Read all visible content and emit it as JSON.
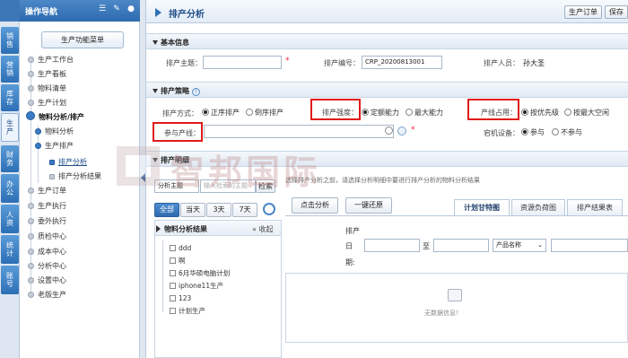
{
  "left_tabs": [
    "销售",
    "营销",
    "库存",
    "生产",
    "财务",
    "办公",
    "人资",
    "统计",
    "账号"
  ],
  "nav": {
    "title": "操作导航",
    "menu_button": "生产功能菜单",
    "items": [
      {
        "label": "生产工作台"
      },
      {
        "label": "生产看板"
      },
      {
        "label": "物料清单"
      },
      {
        "label": "生产计划"
      },
      {
        "label": "物料分析/排产"
      },
      {
        "label": "物料分析"
      },
      {
        "label": "生产排产"
      },
      {
        "label": "排产分析"
      },
      {
        "label": "排产分析结果"
      },
      {
        "label": "生产订单"
      },
      {
        "label": "生产执行"
      },
      {
        "label": "委外执行"
      },
      {
        "label": "质检中心"
      },
      {
        "label": "成本中心"
      },
      {
        "label": "分析中心"
      },
      {
        "label": "设置中心"
      },
      {
        "label": "老版生产"
      }
    ]
  },
  "header": {
    "title": "排产分析",
    "buttons": [
      "生产订单",
      "保存"
    ]
  },
  "basic": {
    "section_title": "基本信息",
    "theme_label": "排产主题：",
    "theme_value": "",
    "code_label": "排产编号：",
    "code_value": "CRP_20200813001",
    "person_label": "排产人员：",
    "person_value": "孙大圣"
  },
  "strategy": {
    "section_title": "排产策略",
    "mode_label": "排产方式：",
    "mode_options": [
      "正序排产",
      "倒序排产"
    ],
    "intensity_label": "排产强度：",
    "intensity_options": [
      "定额能力",
      "最大能力"
    ],
    "line_label": "产线占用：",
    "line_options": [
      "按优先级",
      "按最大空闲"
    ],
    "line_select_label": "参与产线：",
    "line_select_value": "",
    "device_label": "宕机设备：",
    "device_options": [
      "参与",
      "不参与"
    ]
  },
  "detail": {
    "section_title": "排产明细",
    "filter_select": "分析主题",
    "filter_placeholder": "输入检索的主题",
    "search_button": "检索",
    "hint": "选择排产分析之前，请选择分析明细中要进行排产分析的物料分析结果",
    "date_tabs": [
      "全部",
      "当天",
      "3天",
      "7天"
    ],
    "btn_click_analyze": "点击分析",
    "btn_restore": "一键还原",
    "result_tabs": [
      "计划甘特图",
      "资源负荷图",
      "排产结果表"
    ],
    "panel_title": "物料分析结果",
    "collapse_label": "收起",
    "tree_items": [
      "ddd",
      "啊",
      "6月华硕电脑计划",
      "iphone11生产",
      "123",
      "计划生产"
    ],
    "date_label_1": "排产",
    "date_label_2": "日",
    "date_label_3": "期:",
    "date_to": "至",
    "product_select": "产品名称",
    "empty_text": "无数据信息！"
  },
  "watermark": "智邦国际"
}
